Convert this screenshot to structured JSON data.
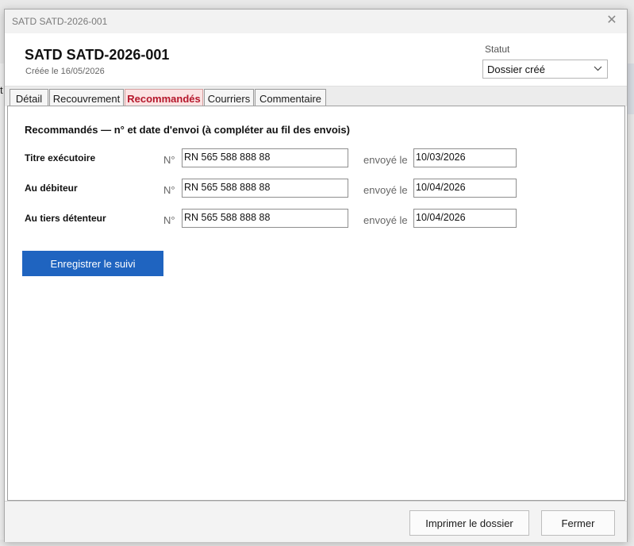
{
  "background": {
    "cut_text": "t"
  },
  "window": {
    "titlebar_text": "SATD SATD-2026-001",
    "close_glyph": "✕"
  },
  "header": {
    "title": "SATD SATD-2026-001",
    "created": "Créée le 16/05/2026",
    "statut_label": "Statut",
    "statut_value": "Dossier créé"
  },
  "tabs": [
    {
      "label": "Détail",
      "active": false
    },
    {
      "label": "Recouvrement",
      "active": false
    },
    {
      "label": "Recommandés",
      "active": true
    },
    {
      "label": "Courriers",
      "active": false
    },
    {
      "label": "Commentaire",
      "active": false
    }
  ],
  "panel": {
    "section_title": "Recommandés — n° et date d'envoi (à compléter au fil des envois)",
    "no_label": "N°",
    "sent_label": "envoyé le",
    "rows": [
      {
        "label": "Titre exécutoire",
        "number": "RN 565 588 888 88",
        "date": "10/03/2026"
      },
      {
        "label": "Au débiteur",
        "number": "RN 565 588 888 88",
        "date": "10/04/2026"
      },
      {
        "label": "Au tiers détenteur",
        "number": "RN 565 588 888 88",
        "date": "10/04/2026"
      }
    ],
    "save_button": "Enregistrer le suivi"
  },
  "footer": {
    "print_button": "Imprimer le dossier",
    "close_button": "Fermer"
  },
  "colors": {
    "accent_blue": "#1f64c0",
    "active_tab_text": "#b5172b",
    "active_tab_bg": "#fbe3e3"
  }
}
